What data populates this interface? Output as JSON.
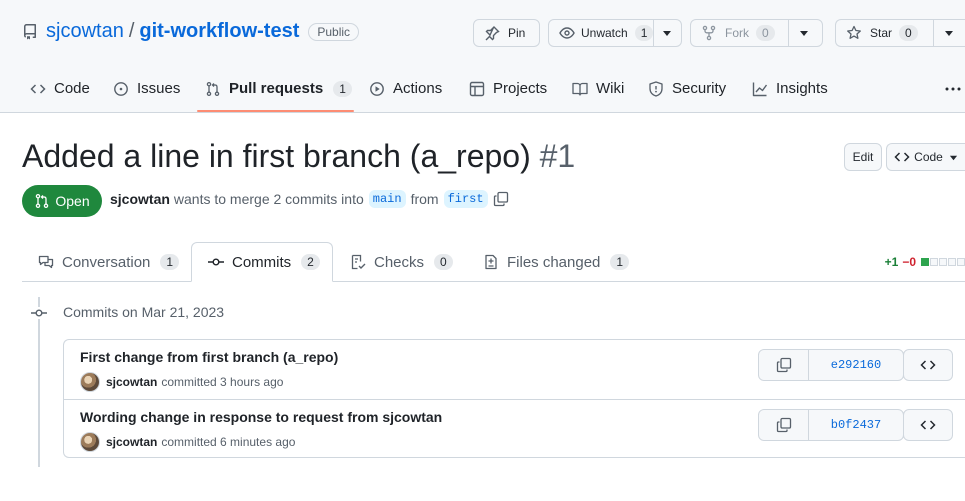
{
  "repo": {
    "owner": "sjcowtan",
    "separator": "/",
    "name": "git-workflow-test",
    "visibility": "Public"
  },
  "repo_actions": {
    "pin_label": "Pin",
    "unwatch_label": "Unwatch",
    "unwatch_count": "1",
    "fork_label": "Fork",
    "fork_count": "0",
    "star_label": "Star",
    "star_count": "0"
  },
  "nav": {
    "code": "Code",
    "issues": "Issues",
    "pull_requests": "Pull requests",
    "pull_requests_count": "1",
    "actions": "Actions",
    "projects": "Projects",
    "wiki": "Wiki",
    "security": "Security",
    "insights": "Insights"
  },
  "pr": {
    "title": "Added a line in first branch (a_repo)",
    "number": "#1",
    "edit_label": "Edit",
    "code_label": "Code",
    "state": "Open",
    "author": "sjcowtan",
    "merge_text": "wants to merge 2 commits into",
    "base_branch": "main",
    "from_text": "from",
    "head_branch": "first"
  },
  "tabs": {
    "conversation": "Conversation",
    "conversation_count": "1",
    "commits": "Commits",
    "commits_count": "2",
    "checks": "Checks",
    "checks_count": "0",
    "files_changed": "Files changed",
    "files_changed_count": "1"
  },
  "diffstat": {
    "additions": "+1",
    "deletions": "−0"
  },
  "commits_section": {
    "date_heading": "Commits on Mar 21, 2023",
    "commits": [
      {
        "message": "First change from first branch (a_repo)",
        "author": "sjcowtan",
        "time": "committed 3 hours ago",
        "sha": "e292160"
      },
      {
        "message": "Wording change in response to request from sjcowtan",
        "author": "sjcowtan",
        "time": "committed 6 minutes ago",
        "sha": "b0f2437"
      }
    ]
  }
}
